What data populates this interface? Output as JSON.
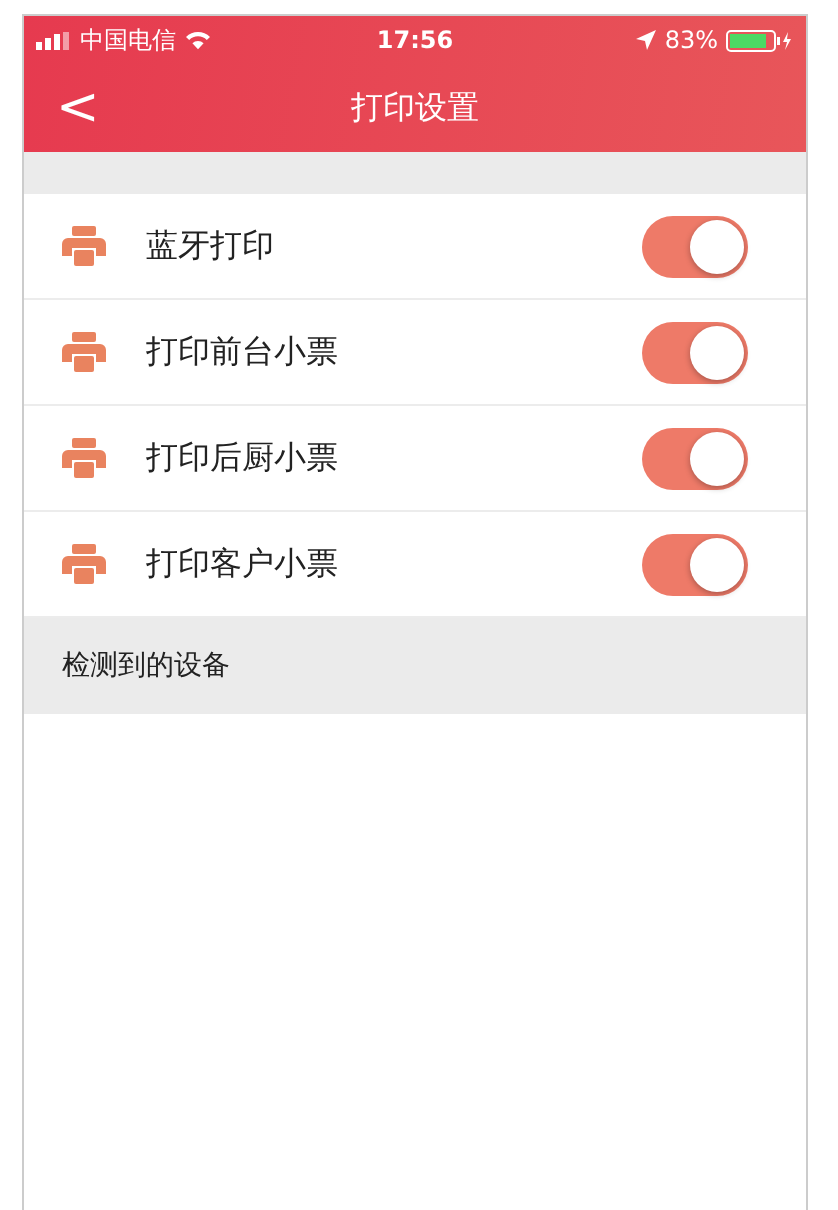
{
  "status_bar": {
    "carrier": "中国电信",
    "time": "17:56",
    "battery": "83%"
  },
  "nav": {
    "back": "<",
    "title": "打印设置"
  },
  "settings": [
    {
      "label": "蓝牙打印",
      "on": true
    },
    {
      "label": "打印前台小票",
      "on": true
    },
    {
      "label": "打印后厨小票",
      "on": true
    },
    {
      "label": "打印客户小票",
      "on": true
    }
  ],
  "section": {
    "title": "检测到的设备"
  }
}
